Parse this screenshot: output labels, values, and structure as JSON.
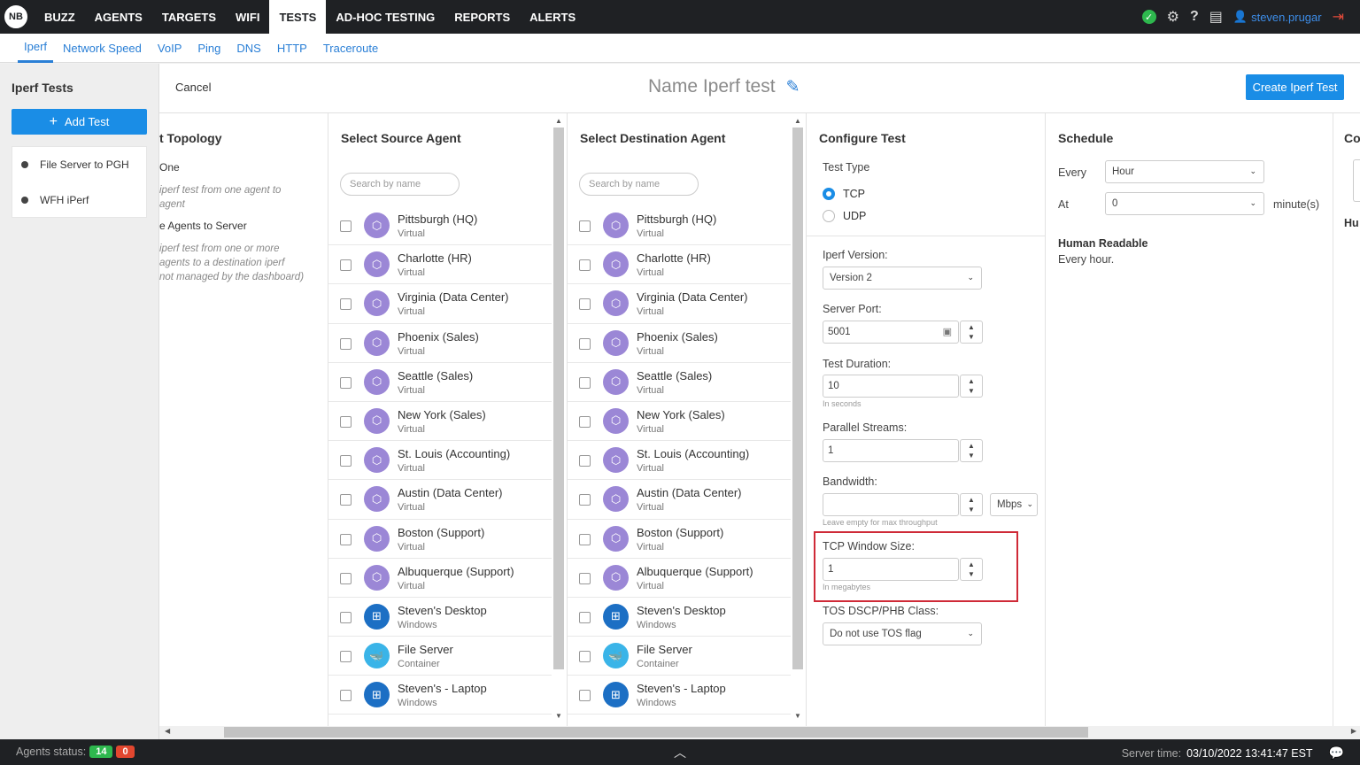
{
  "topnav": {
    "logo": "NB",
    "items": [
      "BUZZ",
      "AGENTS",
      "TARGETS",
      "WIFI",
      "TESTS",
      "AD-HOC TESTING",
      "REPORTS",
      "ALERTS"
    ],
    "active": "TESTS",
    "username": "steven.prugar"
  },
  "subnav": {
    "items": [
      "Iperf",
      "Network Speed",
      "VoIP",
      "Ping",
      "DNS",
      "HTTP",
      "Traceroute"
    ],
    "active": "Iperf"
  },
  "sidebar": {
    "title": "Iperf Tests",
    "add_label": "Add Test",
    "tests": [
      "File Server to PGH",
      "WFH iPerf"
    ]
  },
  "header": {
    "cancel": "Cancel",
    "test_name": "Name Iperf test",
    "create_label": "Create Iperf Test"
  },
  "topology": {
    "title": "t Topology",
    "opt1": "One",
    "opt1_desc1": "iperf test from one agent to",
    "opt1_desc2": "agent",
    "opt2": "e Agents to Server",
    "opt2_desc1": "iperf test from one or more",
    "opt2_desc2": "agents to a destination iperf",
    "opt2_desc3": "not managed by the dashboard)"
  },
  "source": {
    "title": "Select Source Agent",
    "search_placeholder": "Search by name"
  },
  "destination": {
    "title": "Select Destination Agent",
    "search_placeholder": "Search by name"
  },
  "agents": [
    {
      "name": "Pittsburgh (HQ)",
      "type": "Virtual",
      "icon": "virtual-agent-icon"
    },
    {
      "name": "Charlotte (HR)",
      "type": "Virtual",
      "icon": "virtual-agent-icon"
    },
    {
      "name": "Virginia (Data Center)",
      "type": "Virtual",
      "icon": "virtual-agent-icon"
    },
    {
      "name": "Phoenix (Sales)",
      "type": "Virtual",
      "icon": "virtual-agent-icon"
    },
    {
      "name": "Seattle (Sales)",
      "type": "Virtual",
      "icon": "virtual-agent-icon"
    },
    {
      "name": "New York (Sales)",
      "type": "Virtual",
      "icon": "virtual-agent-icon"
    },
    {
      "name": "St. Louis (Accounting)",
      "type": "Virtual",
      "icon": "virtual-agent-icon"
    },
    {
      "name": "Austin (Data Center)",
      "type": "Virtual",
      "icon": "virtual-agent-icon"
    },
    {
      "name": "Boston (Support)",
      "type": "Virtual",
      "icon": "virtual-agent-icon"
    },
    {
      "name": "Albuquerque (Support)",
      "type": "Virtual",
      "icon": "virtual-agent-icon"
    },
    {
      "name": "Steven's Desktop",
      "type": "Windows",
      "icon": "windows-icon"
    },
    {
      "name": "File Server",
      "type": "Container",
      "icon": "docker-icon"
    },
    {
      "name": "Steven's - Laptop",
      "type": "Windows",
      "icon": "windows-icon"
    }
  ],
  "config": {
    "title": "Configure Test",
    "test_type_label": "Test Type",
    "tcp": "TCP",
    "udp": "UDP",
    "version_label": "Iperf Version:",
    "version_value": "Version 2",
    "port_label": "Server Port:",
    "port_value": "5001",
    "duration_label": "Test Duration:",
    "duration_value": "10",
    "duration_hint": "In seconds",
    "streams_label": "Parallel Streams:",
    "streams_value": "1",
    "bandwidth_label": "Bandwidth:",
    "bandwidth_value": "",
    "bandwidth_unit": "Mbps",
    "bandwidth_hint": "Leave empty for max throughput",
    "window_label": "TCP Window Size:",
    "window_value": "1",
    "window_hint": "In megabytes",
    "tos_label": "TOS DSCP/PHB Class:",
    "tos_value": "Do not use TOS flag"
  },
  "schedule": {
    "title": "Schedule",
    "every_label": "Every",
    "every_value": "Hour",
    "at_label": "At",
    "at_value": "0",
    "unit": "minute(s)",
    "hr_label": "Human Readable",
    "hr_value": "Every hour."
  },
  "extra_col": {
    "title": "Co",
    "sub": "Hu"
  },
  "footer": {
    "agents_label": "Agents status:",
    "online": "14",
    "offline": "0",
    "time_label": "Server time:",
    "time_value": "03/10/2022 13:41:47 EST"
  },
  "colors": {
    "accent": "#1a8de6",
    "highlight": "#cf2a37",
    "online": "#2eb84e",
    "offline": "#e2472f"
  }
}
